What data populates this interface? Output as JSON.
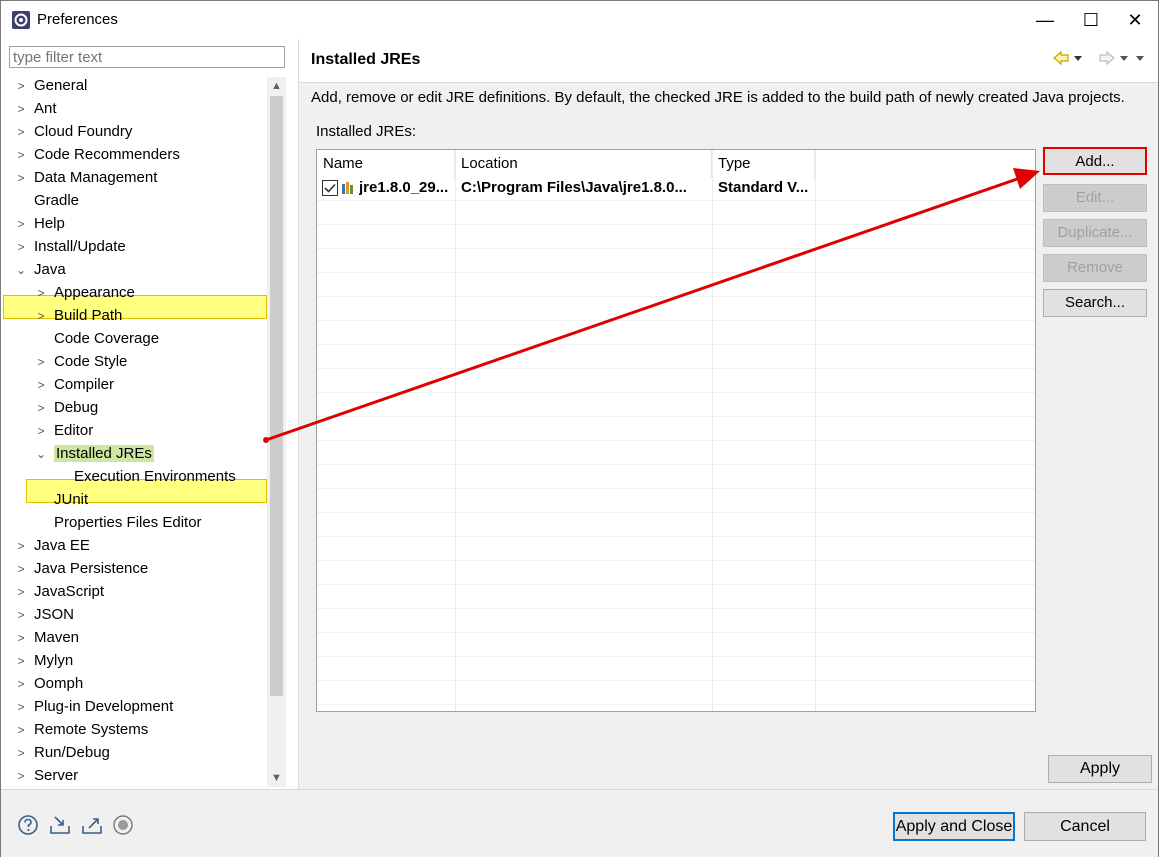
{
  "window": {
    "title": "Preferences",
    "minimize_glyph": "—",
    "maximize_glyph": "☐",
    "close_glyph": "✕"
  },
  "filter": {
    "placeholder": "type filter text"
  },
  "tree": {
    "general": "General",
    "ant": "Ant",
    "cloud_foundry": "Cloud Foundry",
    "code_recommenders": "Code Recommenders",
    "data_management": "Data Management",
    "gradle": "Gradle",
    "help": "Help",
    "install_update": "Install/Update",
    "java": "Java",
    "appearance": "Appearance",
    "build_path": "Build Path",
    "code_coverage": "Code Coverage",
    "code_style": "Code Style",
    "compiler": "Compiler",
    "debug": "Debug",
    "editor": "Editor",
    "installed_jres": "Installed JREs",
    "execution_environments": "Execution Environments",
    "junit": "JUnit",
    "properties_files_editor": "Properties Files Editor",
    "java_ee": "Java EE",
    "java_persistence": "Java Persistence",
    "javascript": "JavaScript",
    "json": "JSON",
    "maven": "Maven",
    "mylyn": "Mylyn",
    "oomph": "Oomph",
    "plugin_development": "Plug-in Development",
    "remote_systems": "Remote Systems",
    "run_debug": "Run/Debug",
    "server": "Server"
  },
  "page": {
    "title": "Installed JREs",
    "description": "Add, remove or edit JRE definitions. By default, the checked JRE is added to the build path of newly created Java projects.",
    "list_label": "Installed JREs:",
    "columns": {
      "name": "Name",
      "location": "Location",
      "type": "Type"
    },
    "rows": [
      {
        "name": "jre1.8.0_29...",
        "location": "C:\\Program Files\\Java\\jre1.8.0...",
        "type": "Standard V..."
      }
    ],
    "buttons": {
      "add": "Add...",
      "edit": "Edit...",
      "duplicate": "Duplicate...",
      "remove": "Remove",
      "search": "Search..."
    },
    "apply": "Apply"
  },
  "footer": {
    "apply_and_close": "Apply and Close",
    "cancel": "Cancel"
  },
  "colors": {
    "highlight": "#ffff80",
    "annotation_red": "#e00000",
    "nav_arrow": "#c8a000"
  }
}
